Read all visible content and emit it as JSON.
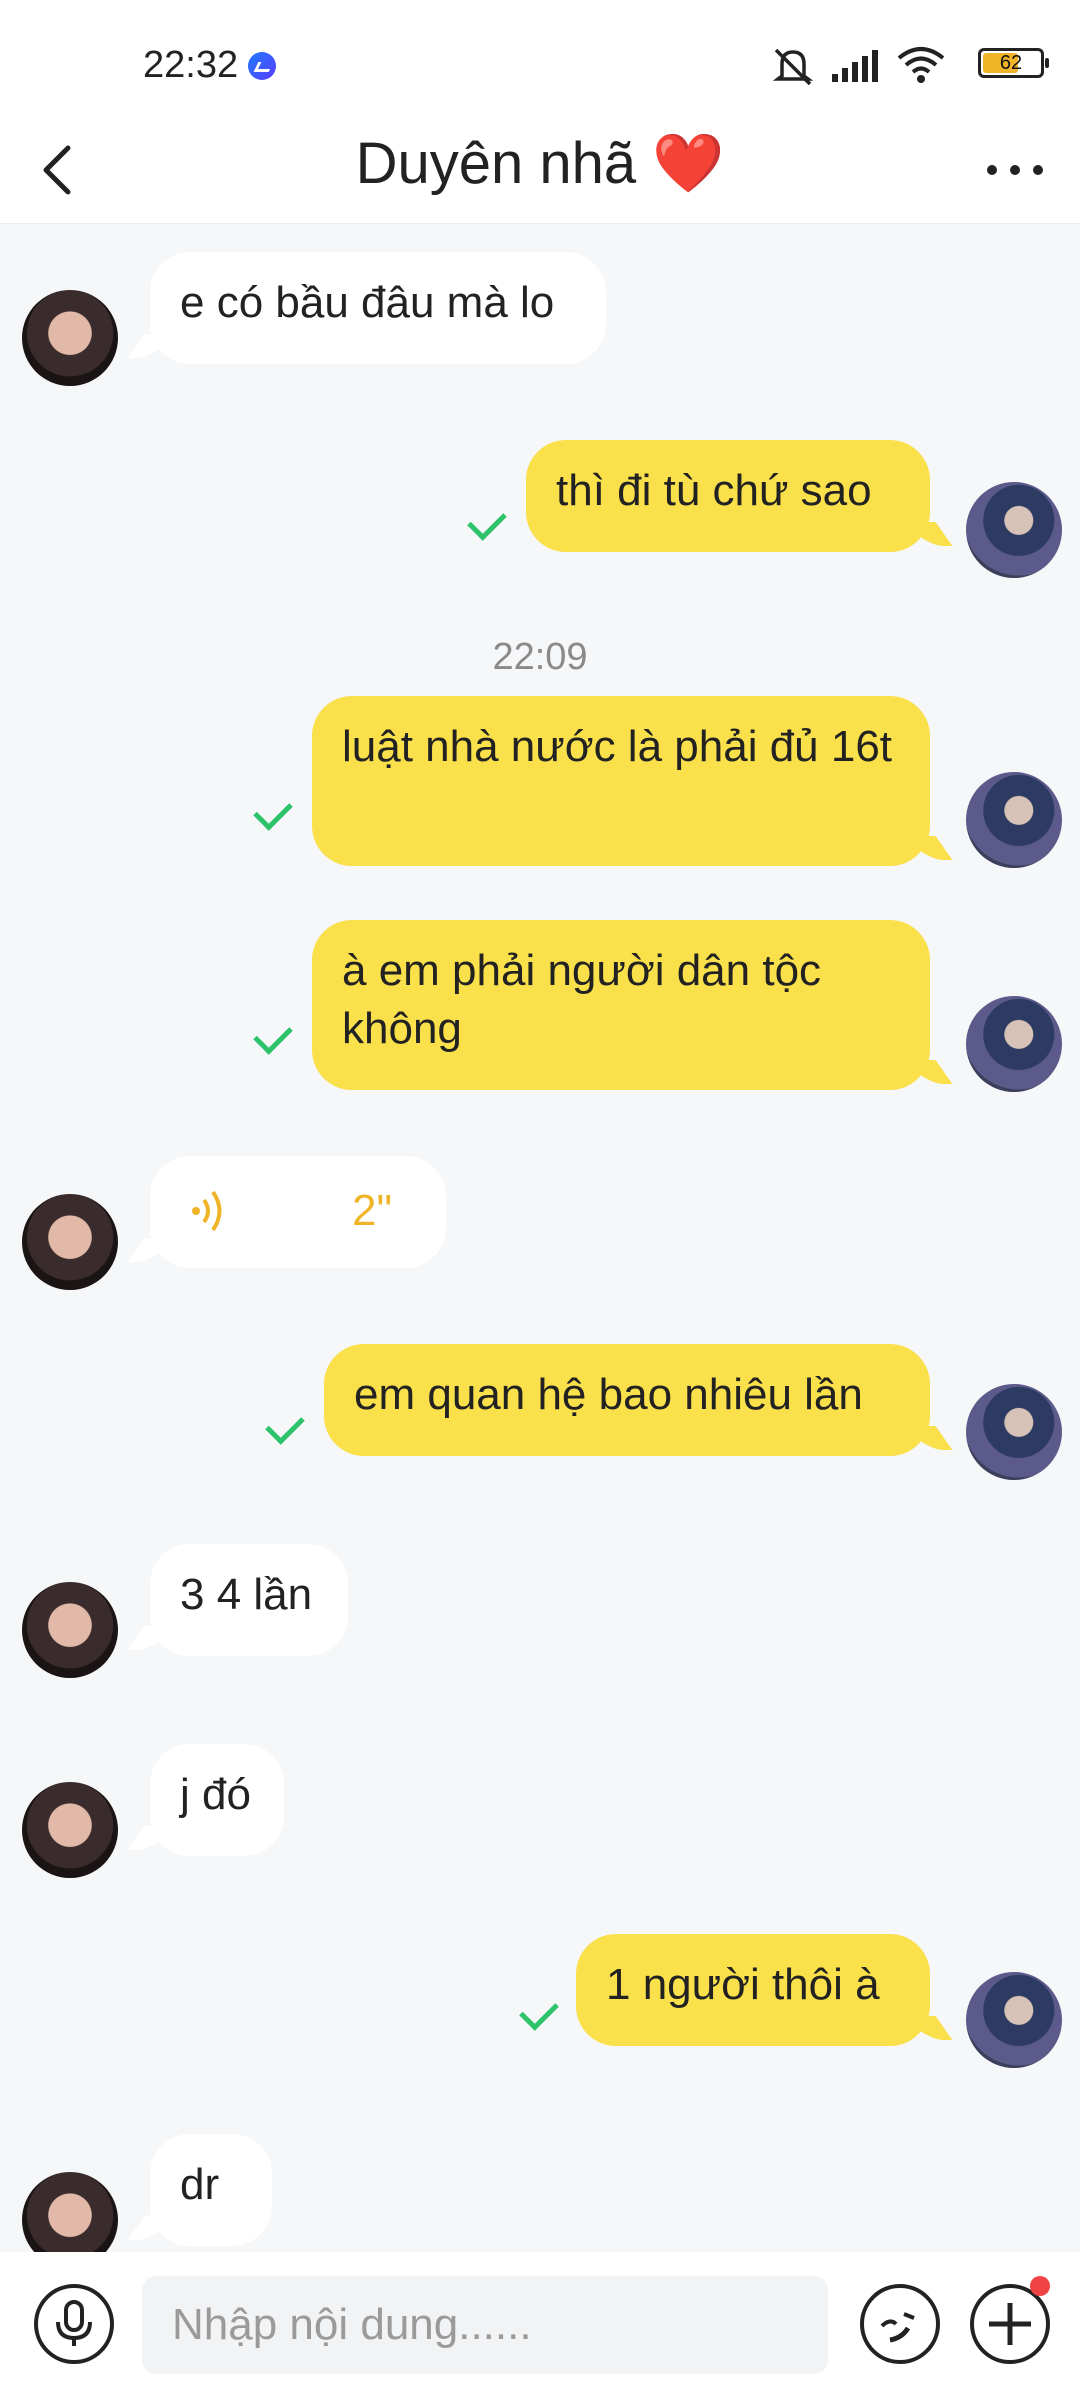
{
  "status_bar": {
    "time": "22:32",
    "battery": "62",
    "battery_level": 0.62
  },
  "header": {
    "title": "Duyên nhã ❤️"
  },
  "messages": [
    {
      "side": "in",
      "text": "e có bầu đâu mà lo"
    },
    {
      "side": "out",
      "text": "thì đi tù chứ sao"
    },
    {
      "side": "time",
      "text": "22:09"
    },
    {
      "side": "out",
      "text": "luật nhà nước là phải đủ 16t"
    },
    {
      "side": "out",
      "text": "à em phải người dân tộc không"
    },
    {
      "side": "in",
      "type": "voice",
      "duration": "2\""
    },
    {
      "side": "out",
      "text": "em quan hệ bao nhiêu lần"
    },
    {
      "side": "in",
      "text": "3 4 lần"
    },
    {
      "side": "in",
      "text": "j đó"
    },
    {
      "side": "out",
      "text": "1 người thôi à"
    },
    {
      "side": "in",
      "text": "dr"
    }
  ],
  "input": {
    "placeholder": "Nhập nội dung......"
  },
  "colors": {
    "out_bubble": "#fae04a",
    "in_bubble": "#ffffff",
    "sent_check": "#2cc36b",
    "voice": "#f0b428"
  }
}
